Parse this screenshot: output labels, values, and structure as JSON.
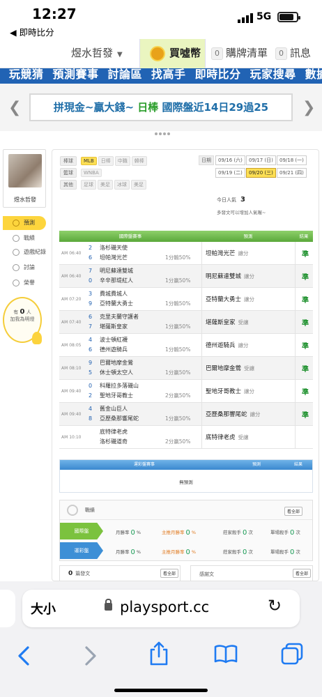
{
  "status": {
    "time": "12:27",
    "back_app": "◀ 即時比分",
    "network": "5G"
  },
  "topnav": {
    "user": "煜水哲發",
    "coin_label": "買噓幣",
    "buy_count": "0",
    "buy_label": "購牌清單",
    "msg_count": "0",
    "msg_label": "訊息"
  },
  "bluenav": [
    "玩競猜",
    "預測賽事",
    "討論區",
    "找高手",
    "即時比分",
    "玩家搜尋",
    "數據"
  ],
  "banner": {
    "part1": "拼現金~贏大錢~",
    "part2": "日棒",
    "part3": "國際盤近14日29過25"
  },
  "sidebar": {
    "name": "煜水哲發",
    "items": [
      "預測",
      "戰績",
      "遊戲紀錄",
      "討論",
      "榮譽"
    ],
    "like_prefix": "有",
    "like_count": "0",
    "like_suffix": "人",
    "like_cta": "加我為明燈"
  },
  "filters": {
    "row1_label": "棒球",
    "row1": [
      "MLB",
      "日棒",
      "中職",
      "韓棒"
    ],
    "row2_label": "籃球",
    "row2": [
      "WNBA"
    ],
    "row3_label": "其他",
    "row3": [
      "足球",
      "美足",
      "冰球",
      "美足"
    ],
    "date_label": "日期",
    "dates": [
      "09/16 (六)",
      "09/17 (日)",
      "09/18 (一)",
      "09/19 (二)",
      "09/20 (三)",
      "09/21 (四)"
    ]
  },
  "popularity": {
    "label": "今日人氣",
    "value": "3",
    "note": "多發文可以增加人氣喔~"
  },
  "table": {
    "headers": [
      "國際盤賽事",
      "預測",
      "結果"
    ],
    "rows": [
      {
        "time": "AM 06:40",
        "n1": "2",
        "t1": "洛杉磯天使",
        "n2": "6",
        "t2": "坦帕灣光芒",
        "odds": "1分輸50%",
        "pick": "坦帕灣光芒",
        "pick_type": "讓分",
        "result": "準"
      },
      {
        "time": "AM 06:40",
        "n1": "7",
        "t1": "明尼蘇達雙城",
        "n2": "0",
        "t2": "辛辛那堤紅人",
        "odds": "1分贏50%",
        "pick": "明尼蘇達雙城",
        "pick_type": "讓分",
        "result": "準"
      },
      {
        "time": "AM 07:20",
        "n1": "3",
        "t1": "費城費城人",
        "n2": "9",
        "t2": "亞特蘭大勇士",
        "odds": "1分輸50%",
        "pick": "亞特蘭大勇士",
        "pick_type": "讓分",
        "result": "準"
      },
      {
        "time": "AM 07:40",
        "n1": "6",
        "t1": "克里夫蘭守護者",
        "n2": "7",
        "t2": "堪薩斯皇家",
        "odds": "1分贏50%",
        "pick": "堪薩斯皇家",
        "pick_type": "受讓",
        "result": "準"
      },
      {
        "time": "AM 08:05",
        "n1": "4",
        "t1": "波士頓紅襪",
        "n2": "6",
        "t2": "德州遊騎兵",
        "odds": "1分輸50%",
        "pick": "德州遊騎兵",
        "pick_type": "讓分",
        "result": "準"
      },
      {
        "time": "AM 08:10",
        "n1": "9",
        "t1": "巴爾地摩金鶯",
        "n2": "5",
        "t2": "休士頓太空人",
        "odds": "1分贏50%",
        "pick": "巴爾地摩金鶯",
        "pick_type": "受讓",
        "result": "準"
      },
      {
        "time": "AM 09:40",
        "n1": "0",
        "t1": "科羅拉多落磯山",
        "n2": "2",
        "t2": "聖地牙哥教士",
        "odds": "2分贏50%",
        "pick": "聖地牙哥教士",
        "pick_type": "讓分",
        "result": "準"
      },
      {
        "time": "AM 09:40",
        "n1": "4",
        "t1": "舊金山巨人",
        "n2": "8",
        "t2": "亞歷桑那響尾蛇",
        "odds": "1分贏50%",
        "pick": "亞歷桑那響尾蛇",
        "pick_type": "讓分",
        "result": "準"
      },
      {
        "time": "AM 10:10",
        "n1": "",
        "t1": "底特律老虎",
        "n2": "",
        "t2": "洛杉磯道奇",
        "odds": "2分贏50%",
        "pick": "底特律老虎",
        "pick_type": "受讓",
        "result": ""
      }
    ]
  },
  "table2": {
    "headers": [
      "運彩盤賽事",
      "預測",
      "結果"
    ],
    "empty": "無預測"
  },
  "stats": {
    "title": "戰績",
    "more": "看全部",
    "rows": [
      {
        "tag": "國際盤",
        "color": "#7bc23e",
        "c1_label": "月勝率",
        "c1": "0",
        "c2_label": "主推月勝率",
        "c2": "0",
        "c3_label": "莊家殺手",
        "c3": "0",
        "c4_label": "單場殺手",
        "c4": "0"
      },
      {
        "tag": "運彩盤",
        "color": "#3d8fd6",
        "c1_label": "月勝率",
        "c1": "0",
        "c2_label": "主推月勝率",
        "c2": "0",
        "c3_label": "莊家殺手",
        "c3": "0",
        "c4_label": "單場殺手",
        "c4": "0"
      }
    ]
  },
  "posts": {
    "count": "0",
    "label": "篇發文",
    "more": "看全部",
    "reply_label": "感謝文",
    "reply_more": "看全部"
  },
  "browser": {
    "aa": "大小",
    "url": "playsport.cc"
  }
}
